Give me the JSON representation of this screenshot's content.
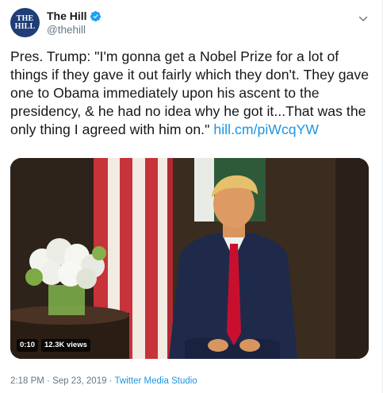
{
  "account": {
    "name": "The Hill",
    "handle": "@thehill",
    "avatar_text_line1": "THE",
    "avatar_text_line2": "HILL"
  },
  "tweet": {
    "text": "Pres. Trump: \"I'm gonna get a Nobel Prize for a lot of things if they gave it out fairly which they don't. They gave one to Obama immediately upon his ascent to the presidency, & he had no idea why he got it...That was the only thing I agreed with him on.\"",
    "link": "hill.cm/piWcqYW"
  },
  "video": {
    "time": "0:10",
    "views": "12.3K views"
  },
  "meta": {
    "time": "2:18 PM",
    "separator1": " · ",
    "date": "Sep 23, 2019",
    "separator2": " · ",
    "source": "Twitter Media Studio"
  },
  "colors": {
    "link": "#1b95e0",
    "verified": "#1da1f2",
    "secondary_text": "#657786"
  },
  "icons": {
    "verified": "verified-badge-icon",
    "menu": "chevron-down-icon",
    "avatar": "the-hill-logo"
  }
}
